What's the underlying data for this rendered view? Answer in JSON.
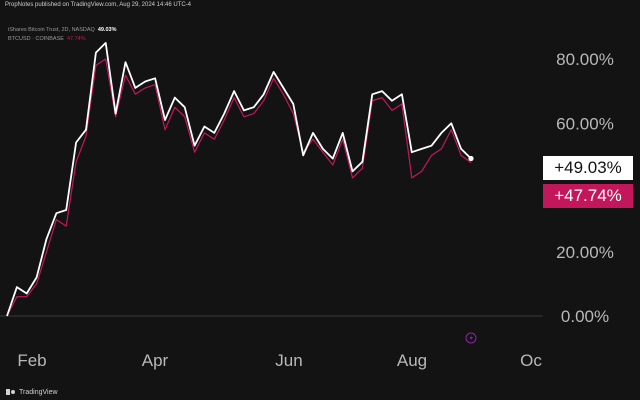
{
  "header": {
    "publisher_line": "PropNotes published on TradingView.com, Aug 29, 2024 14:46 UTC-4"
  },
  "legend": {
    "series1_label": "iShares Bitcoin Trust, 2D, NASDAQ",
    "series1_value": "49.03%",
    "series2_label": "BTCUSD · COINBASE",
    "series2_value": "47.74%"
  },
  "badges": {
    "series1": "+49.03%",
    "series2": "+47.74%"
  },
  "footer": {
    "brand": "TradingView"
  },
  "colors": {
    "series1": "#ffffff",
    "series2": "#c2185b",
    "axis_text": "#b8b8b8",
    "baseline": "#3a3a3a"
  },
  "chart_data": {
    "type": "line",
    "x_ticks": [
      "Feb",
      "Apr",
      "Jun",
      "Aug",
      "Oc"
    ],
    "y_ticks": [
      "80.00%",
      "60.00%",
      "20.00%",
      "0.00%"
    ],
    "y_tick_values": [
      80,
      60,
      20,
      0
    ],
    "ylim": [
      -1,
      88
    ],
    "grid": false,
    "series": [
      {
        "name": "iShares Bitcoin Trust",
        "values": [
          0,
          9,
          7,
          12,
          24,
          32,
          33,
          54,
          58,
          82,
          85,
          63,
          79,
          71,
          73,
          74,
          61,
          68,
          65,
          53,
          59,
          57,
          63,
          70,
          64,
          65,
          69,
          76,
          71,
          66,
          50,
          57,
          52,
          49,
          57,
          45,
          48,
          69,
          70,
          67,
          69,
          51,
          52,
          53,
          57,
          60,
          52,
          49.03
        ]
      },
      {
        "name": "BTCUSD",
        "values": [
          0,
          6,
          6,
          10,
          20,
          30,
          28,
          48,
          56,
          78,
          80,
          62,
          75,
          69,
          71,
          72,
          58,
          65,
          62,
          51,
          57,
          55,
          61,
          68,
          62,
          63,
          67,
          74,
          69,
          63,
          51,
          55,
          51,
          47,
          55,
          43,
          46,
          67,
          68,
          64,
          66,
          43,
          45,
          50,
          52,
          58,
          50,
          47.74
        ]
      }
    ]
  }
}
